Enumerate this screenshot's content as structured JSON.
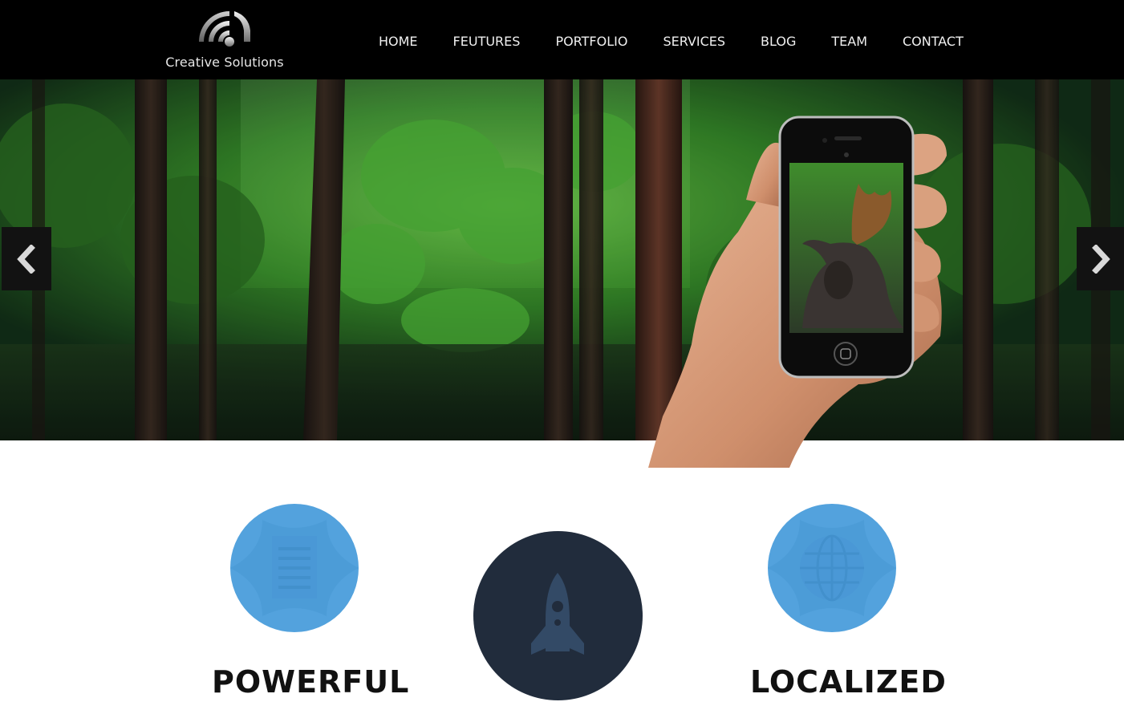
{
  "header": {
    "logo_text": "Creative Solutions",
    "nav": [
      {
        "label": "HOME"
      },
      {
        "label": "FEUTURES"
      },
      {
        "label": "PORTFOLIO"
      },
      {
        "label": "SERVICES"
      },
      {
        "label": "BLOG"
      },
      {
        "label": "TEAM"
      },
      {
        "label": "CONTACT"
      }
    ]
  },
  "hero": {
    "prev_icon": "chevron-left-icon",
    "next_icon": "chevron-right-icon",
    "image": "forest-hand-phone-moose"
  },
  "features": [
    {
      "title": "POWERFUL",
      "icon": "document-icon",
      "color": "#53a2dd"
    },
    {
      "title": "",
      "icon": "rocket-icon",
      "color": "#212c3c"
    },
    {
      "title": "LOCALIZED",
      "icon": "globe-icon",
      "color": "#53a2dd"
    }
  ],
  "colors": {
    "header_bg": "#000000",
    "accent_blue": "#53a2dd",
    "dark_navy": "#212c3c",
    "forest_green": "#3f9d2a"
  }
}
